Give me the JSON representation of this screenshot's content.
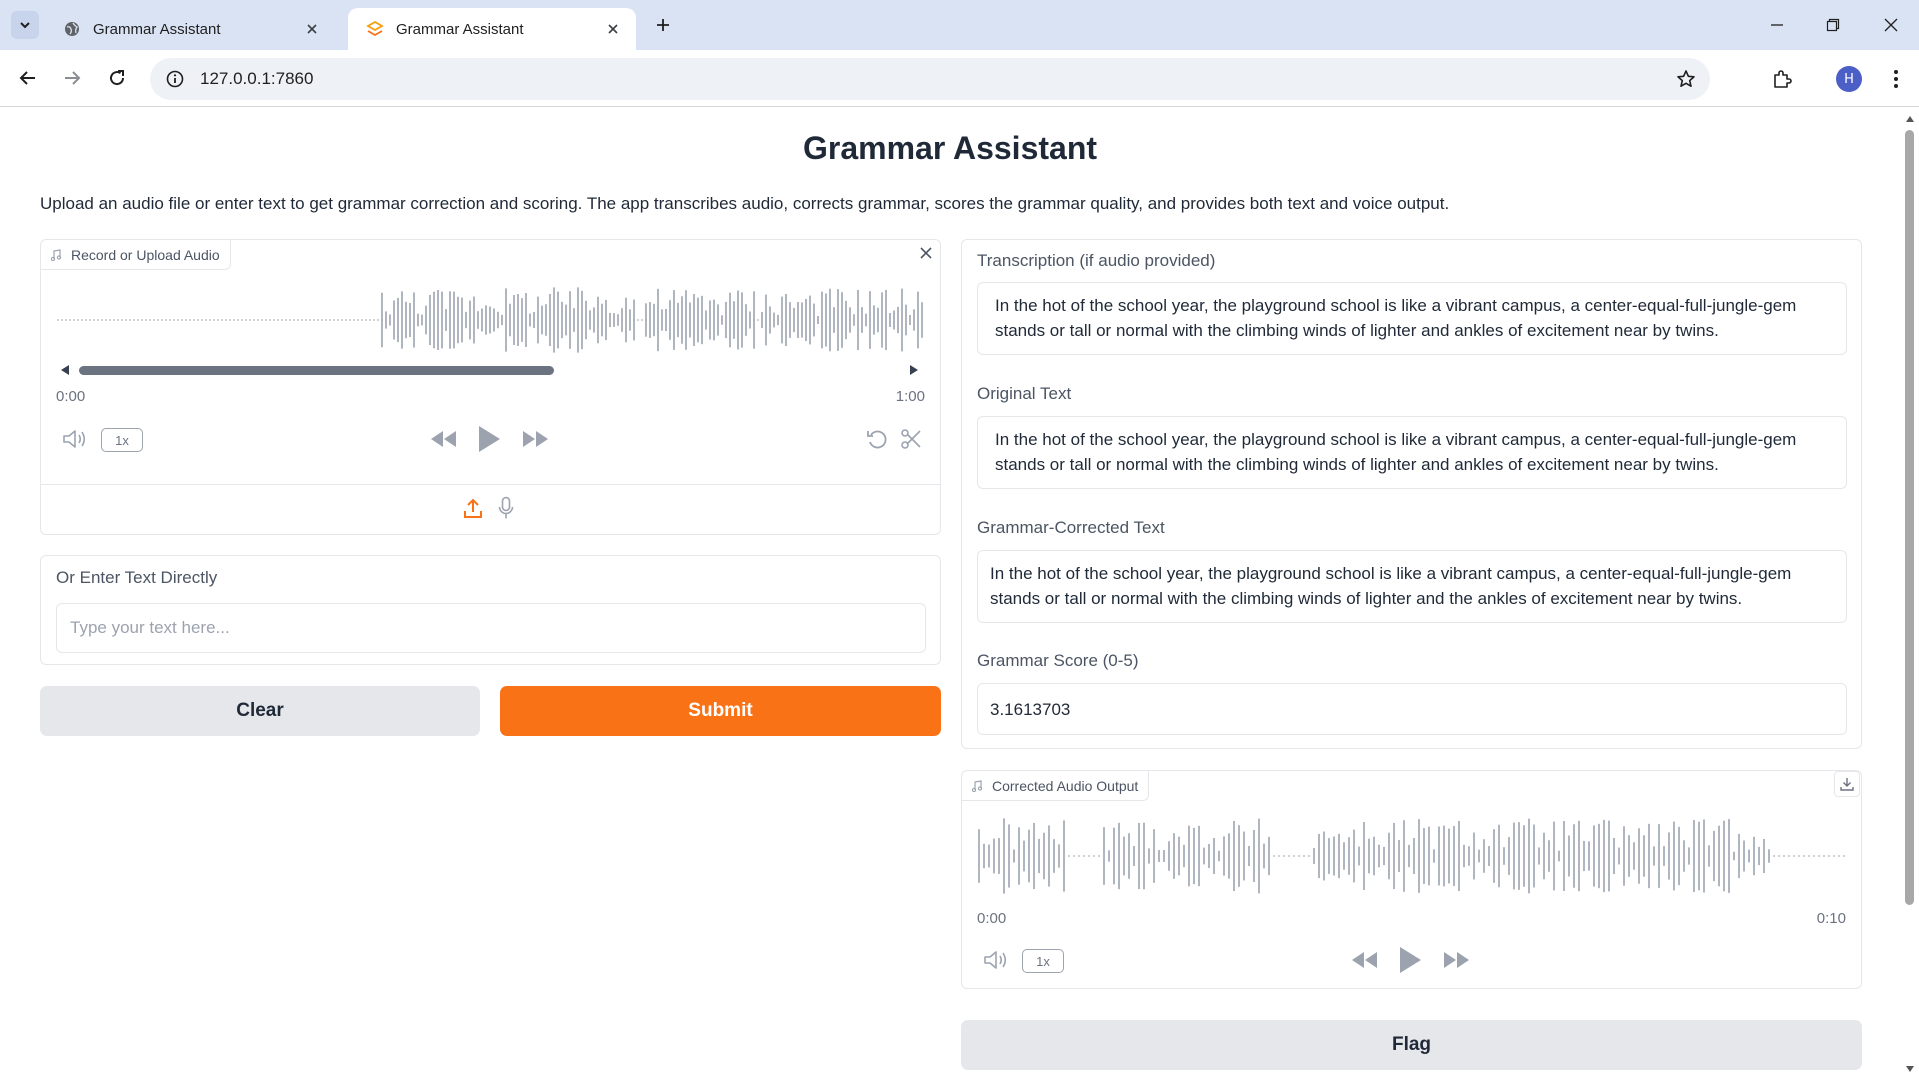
{
  "browser": {
    "tabs": [
      {
        "title": "Grammar Assistant",
        "active": false
      },
      {
        "title": "Grammar Assistant",
        "active": true
      }
    ],
    "url": "127.0.0.1:7860",
    "profile_initial": "H"
  },
  "app": {
    "title": "Grammar Assistant",
    "description": "Upload an audio file or enter text to get grammar correction and scoring. The app transcribes audio, corrects grammar, scores the grammar quality, and provides both text and voice output."
  },
  "audio_input": {
    "label": "Record or Upload Audio",
    "time_start": "0:00",
    "time_end": "1:00",
    "speed": "1x"
  },
  "text_input": {
    "label": "Or Enter Text Directly",
    "placeholder": "Type your text here..."
  },
  "actions": {
    "clear_label": "Clear",
    "submit_label": "Submit",
    "flag_label": "Flag"
  },
  "outputs": {
    "transcription_label": "Transcription (if audio provided)",
    "transcription_text": "In the hot of the school year, the playground school is like a vibrant campus, a center-equal-full-jungle-gem stands or tall or normal with the climbing winds of lighter and ankles of excitement near by twins.",
    "original_label": "Original Text",
    "original_text": "In the hot of the school year, the playground school is like a vibrant campus, a center-equal-full-jungle-gem stands or tall or normal with the climbing winds of lighter and ankles of excitement near by twins.",
    "corrected_label": "Grammar-Corrected Text",
    "corrected_text": "In the hot of the school year, the playground school is like a vibrant campus, a center-equal-full-jungle-gem stands or tall or normal with the climbing winds of lighter and the ankles of excitement near by twins.",
    "score_label": "Grammar Score (0-5)",
    "score_value": "3.1613703"
  },
  "audio_output": {
    "label": "Corrected Audio Output",
    "time_start": "0:00",
    "time_end": "0:10",
    "speed": "1x"
  },
  "colors": {
    "accent": "#f97316",
    "waveform": "#9ca3af",
    "tabbar": "#dae3f3"
  },
  "icons": [
    "tab-list-icon",
    "globe-icon",
    "gradio-icon",
    "close-icon",
    "plus-icon",
    "minimize-icon",
    "restore-icon",
    "back-arrow-icon",
    "forward-arrow-icon",
    "reload-icon",
    "info-icon",
    "star-icon",
    "extensions-icon",
    "more-icon",
    "music-icon",
    "volume-icon",
    "rewind-icon",
    "play-icon",
    "fast-forward-icon",
    "undo-icon",
    "scissors-icon",
    "upload-icon",
    "microphone-icon",
    "download-icon"
  ]
}
